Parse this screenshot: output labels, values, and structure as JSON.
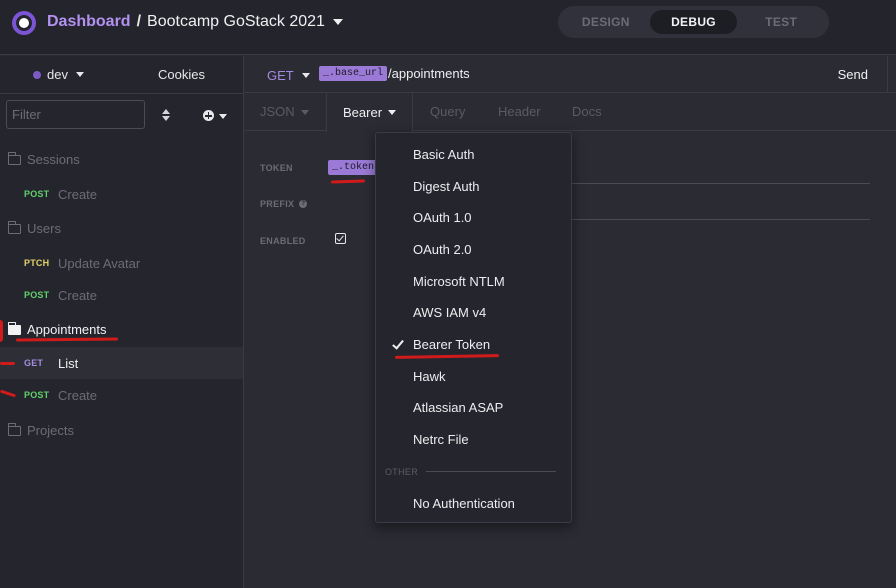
{
  "header": {
    "dashboard_label": "Dashboard",
    "separator": "/",
    "project_name": "Bootcamp GoStack 2021",
    "modes": [
      {
        "label": "DESIGN",
        "active": false
      },
      {
        "label": "DEBUG",
        "active": true
      },
      {
        "label": "TEST",
        "active": false
      }
    ]
  },
  "sidebar": {
    "environment": "dev",
    "cookies_label": "Cookies",
    "filter_placeholder": "Filter",
    "folders": {
      "sessions": "Sessions",
      "users": "Users",
      "appointments": "Appointments",
      "projects": "Projects"
    },
    "requests": {
      "sessions_create": {
        "method": "POST",
        "name": "Create"
      },
      "users_update_avatar": {
        "method": "PTCH",
        "name": "Update Avatar"
      },
      "users_create": {
        "method": "POST",
        "name": "Create"
      },
      "appointments_list": {
        "method": "GET",
        "name": "List"
      },
      "appointments_create": {
        "method": "POST",
        "name": "Create"
      }
    }
  },
  "request": {
    "method": "GET",
    "url_variable": "_.base_url",
    "url_path": "/appointments",
    "send_label": "Send"
  },
  "tabs": {
    "body": "JSON",
    "auth": "Bearer",
    "query": "Query",
    "header": "Header",
    "docs": "Docs"
  },
  "auth_form": {
    "token_label": "TOKEN",
    "token_value": "_.token",
    "prefix_label": "PREFIX",
    "enabled_label": "ENABLED",
    "enabled": true
  },
  "auth_menu": {
    "items": [
      "Basic Auth",
      "Digest Auth",
      "OAuth 1.0",
      "OAuth 2.0",
      "Microsoft NTLM",
      "AWS IAM v4",
      "Bearer Token",
      "Hawk",
      "Atlassian ASAP",
      "Netrc File"
    ],
    "selected": "Bearer Token",
    "other_group_label": "OTHER",
    "other_item": "No Authentication"
  },
  "colors": {
    "accent": "#7c55d6",
    "post": "#60d16a",
    "patch": "#e3d36b",
    "get": "#a58be0",
    "annotation": "#d11a1a"
  }
}
